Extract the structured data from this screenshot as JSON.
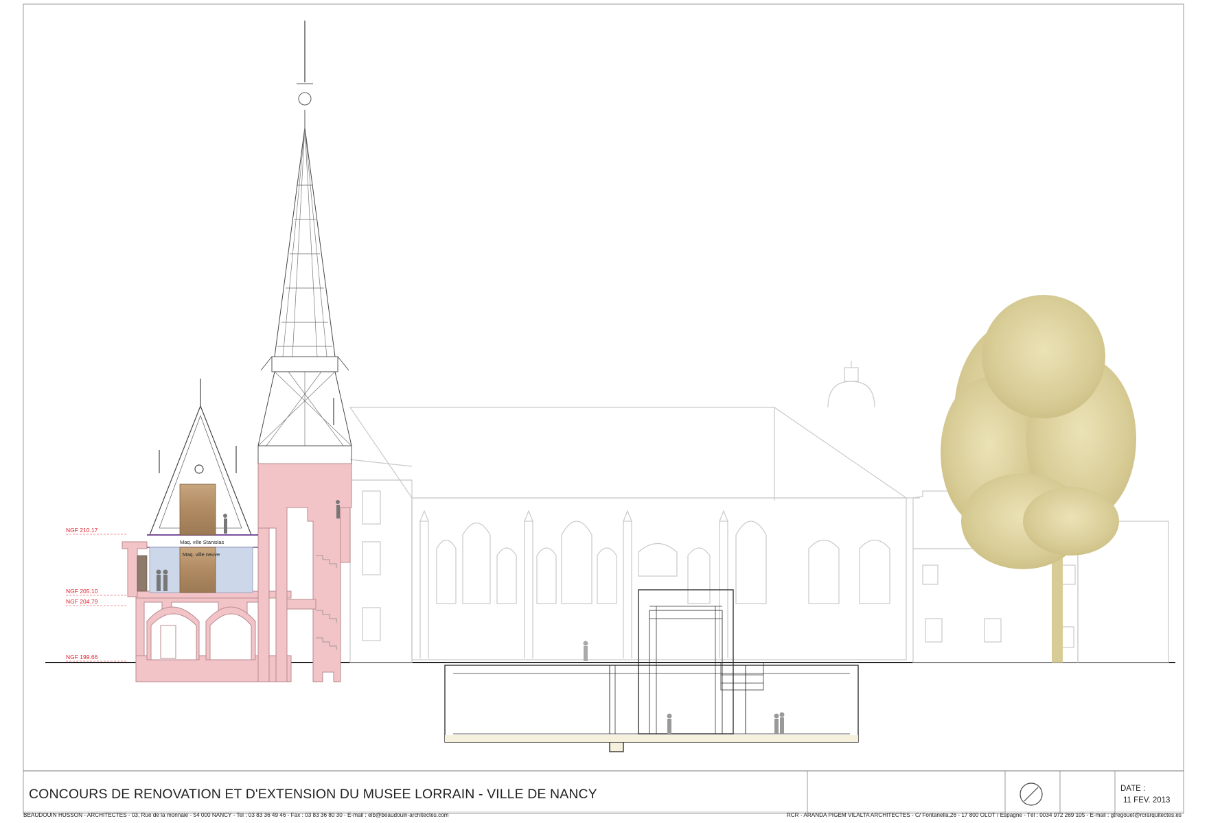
{
  "section_labels": {
    "level_1": "NGF 210.17",
    "level_2": "NGF 205.10",
    "level_3": "NGF 204.79",
    "level_4": "NGF 199.66",
    "exhibit_upper": "Maq. ville Stanislas",
    "exhibit_lower": "Maq. ville neuve"
  },
  "title_block": {
    "title": "CONCOURS DE RENOVATION ET D'EXTENSION DU MUSEE LORRAIN - VILLE DE NANCY",
    "date_label": "DATE :",
    "date_value": "11 FEV. 2013"
  },
  "footer": {
    "left": "BEAUDOUIN HUSSON - ARCHITECTES - 03, Rue de la monnaie - 54 000  NANCY - Tel : 03 83 36 49 46 - Fax : 03 83 36 80 30 - E-mail : elb@beaudouin-architectes.com",
    "right": "RCR - ARANDA PIGEM VILALTA ARCHITECTES - C/ Fontanella,26 - 17 800 OLOT / Espagne - Tél : 0034 972 269 105 - E-mail : gtregouet@rcrarquitectes.es"
  },
  "colors": {
    "section_fill": "#f2c4c8",
    "level_text": "#e0202a",
    "tree": "#d8cc96",
    "elevation_line": "#c9c9c9",
    "blue_fill": "#cdd7ea"
  }
}
